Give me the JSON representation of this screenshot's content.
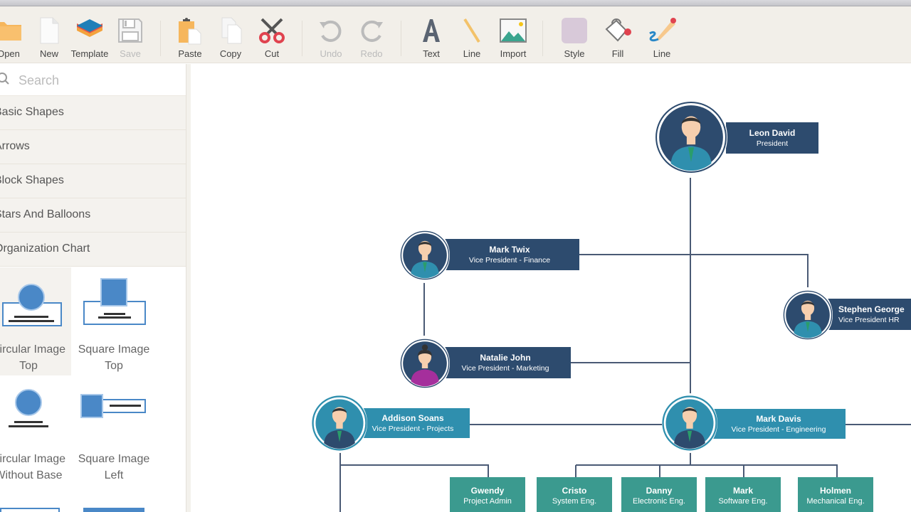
{
  "toolbar": {
    "buttons": [
      {
        "id": "open",
        "label": "Open",
        "icon": "folder-icon",
        "enabled": true
      },
      {
        "id": "new",
        "label": "New",
        "icon": "new-document-icon",
        "enabled": true
      },
      {
        "id": "template",
        "label": "Template",
        "icon": "layers-icon",
        "enabled": true
      },
      {
        "id": "save",
        "label": "Save",
        "icon": "floppy-disk-icon",
        "enabled": false
      },
      {
        "id": "paste",
        "label": "Paste",
        "icon": "clipboard-icon",
        "enabled": true
      },
      {
        "id": "copy",
        "label": "Copy",
        "icon": "copy-icon",
        "enabled": true
      },
      {
        "id": "cut",
        "label": "Cut",
        "icon": "scissors-icon",
        "enabled": true
      },
      {
        "id": "undo",
        "label": "Undo",
        "icon": "undo-icon",
        "enabled": false
      },
      {
        "id": "redo",
        "label": "Redo",
        "icon": "redo-icon",
        "enabled": false
      },
      {
        "id": "text",
        "label": "Text",
        "icon": "text-icon",
        "enabled": true
      },
      {
        "id": "line",
        "label": "Line",
        "icon": "line-icon",
        "enabled": true
      },
      {
        "id": "import",
        "label": "Import",
        "icon": "image-icon",
        "enabled": true
      },
      {
        "id": "style",
        "label": "Style",
        "icon": "style-swatch-icon",
        "enabled": true
      },
      {
        "id": "fill",
        "label": "Fill",
        "icon": "paint-bucket-icon",
        "enabled": true
      },
      {
        "id": "line-style",
        "label": "Line",
        "icon": "pencil-icon",
        "enabled": true
      }
    ]
  },
  "sidebar": {
    "search_placeholder": "Search",
    "categories": [
      {
        "label": "Basic Shapes"
      },
      {
        "label": "Arrows"
      },
      {
        "label": "Block Shapes"
      },
      {
        "label": "Stars And Balloons"
      },
      {
        "label": "Organization Chart"
      }
    ],
    "shapes": [
      {
        "label_line1": "Circular Image",
        "label_line2": "Top",
        "selected": true
      },
      {
        "label_line1": "Square Image",
        "label_line2": "Top",
        "selected": false
      },
      {
        "label_line1": "Circular Image",
        "label_line2": "Without Base",
        "selected": false
      },
      {
        "label_line1": "Square Image",
        "label_line2": "Left",
        "selected": false
      }
    ]
  },
  "colors": {
    "navy": "#2d4b6e",
    "teal_blue": "#2f8fae",
    "green_teal": "#3b9a8f",
    "connector": "#4a5a75",
    "shape_blue": "#4a88c7"
  },
  "org_chart": {
    "president": {
      "name": "Leon David",
      "role": "President"
    },
    "vps_navy": [
      {
        "name": "Mark Twix",
        "role": "Vice President - Finance",
        "gender": "male"
      },
      {
        "name": "Natalie John",
        "role": "Vice President - Marketing",
        "gender": "female"
      },
      {
        "name": "Stephen George",
        "role": "Vice President HR",
        "gender": "male"
      }
    ],
    "vps_teal": [
      {
        "name": "Addison Soans",
        "role": "Vice President - Projects"
      },
      {
        "name": "Mark Davis",
        "role": "Vice President - Engineering"
      }
    ],
    "staff": [
      {
        "name": "Gwendy",
        "role": "Project Admin"
      },
      {
        "name": "Cristo",
        "role": "System Eng."
      },
      {
        "name": "Danny",
        "role": "Electronic Eng."
      },
      {
        "name": "Mark",
        "role": "Software Eng."
      },
      {
        "name": "Holmen",
        "role": "Mechanical Eng."
      }
    ]
  }
}
